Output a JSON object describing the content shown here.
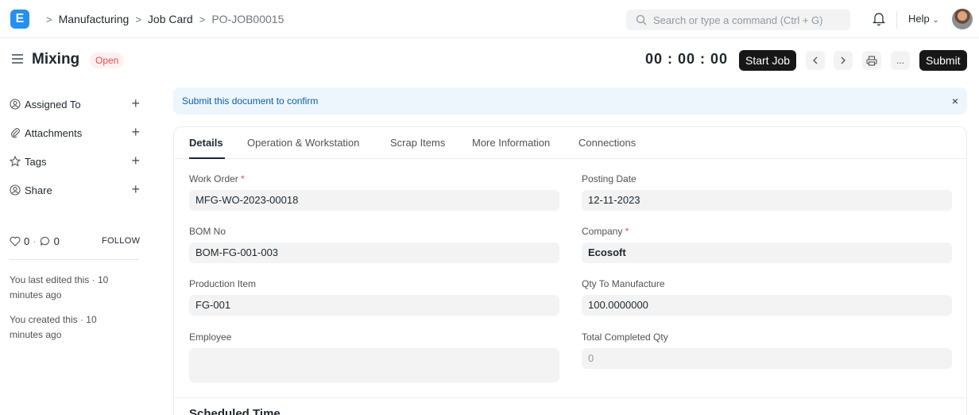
{
  "navbar": {
    "logo_letter": "E",
    "breadcrumbs": [
      "Manufacturing",
      "Job Card",
      "PO-JOB00015"
    ],
    "search_placeholder": "Search or type a command (Ctrl + G)",
    "help_label": "Help"
  },
  "page": {
    "title": "Mixing",
    "status": "Open",
    "timer": "00 : 00 : 00",
    "start_job_label": "Start Job",
    "more_label": "...",
    "submit_label": "Submit"
  },
  "sidebar": {
    "items": [
      {
        "label": "Assigned To",
        "icon": "user-plus-icon"
      },
      {
        "label": "Attachments",
        "icon": "paperclip-icon"
      },
      {
        "label": "Tags",
        "icon": "tag-icon"
      },
      {
        "label": "Share",
        "icon": "share-icon"
      }
    ],
    "likes_count": "0",
    "dot": "·",
    "comments_count": "0",
    "follow_label": "FOLLOW",
    "last_edited": "You last edited this · 10 minutes ago",
    "created": "You created this · 10 minutes ago"
  },
  "alert": {
    "message": "Submit this document to confirm",
    "close": "×"
  },
  "tabs": [
    "Details",
    "Operation & Workstation",
    "Scrap Items",
    "More Information",
    "Connections"
  ],
  "form": {
    "left": [
      {
        "label": "Work Order",
        "required": true,
        "value": "MFG-WO-2023-00018"
      },
      {
        "label": "BOM No",
        "required": false,
        "value": "BOM-FG-001-003"
      },
      {
        "label": "Production Item",
        "required": false,
        "value": "FG-001"
      },
      {
        "label": "Employee",
        "required": false,
        "value": ""
      }
    ],
    "right": [
      {
        "label": "Posting Date",
        "required": false,
        "value": "12-11-2023"
      },
      {
        "label": "Company",
        "required": true,
        "value": "Ecosoft"
      },
      {
        "label": "Qty To Manufacture",
        "required": false,
        "value": "100.0000000"
      },
      {
        "label": "Total Completed Qty",
        "required": false,
        "value": "0"
      }
    ],
    "required_mark": "*"
  },
  "section_title": "Scheduled Time",
  "colors": {
    "primary": "#2490ef",
    "dark_button": "#171717",
    "status_red": "#e24c4c",
    "alert_bg": "#edf6fd",
    "alert_text": "#0b5ea5"
  }
}
